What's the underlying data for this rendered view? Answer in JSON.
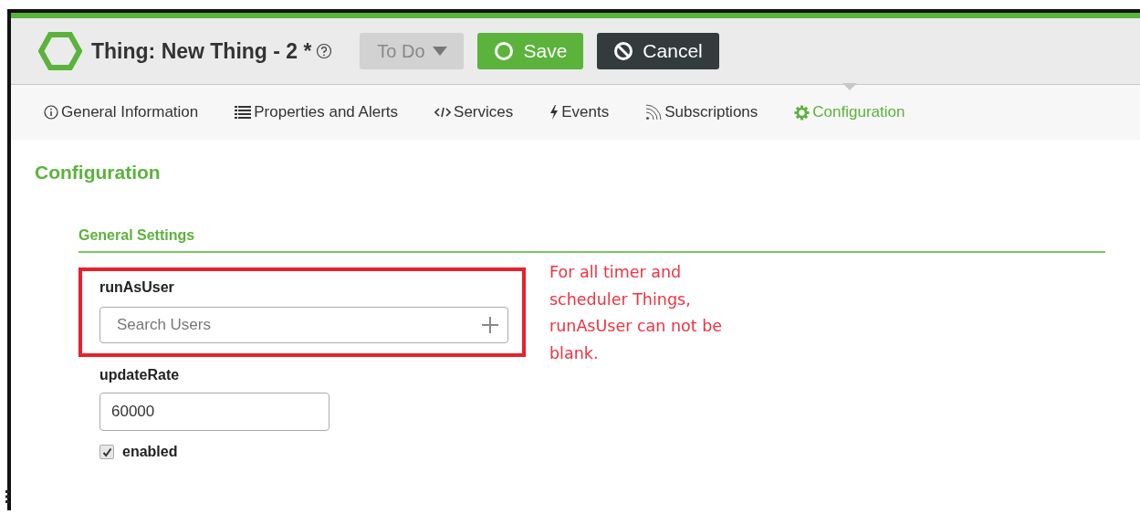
{
  "header": {
    "title": "Thing: New Thing - 2 *",
    "status": {
      "label": "To Do",
      "disabled": true
    },
    "buttons": [
      {
        "kind": "save",
        "label": "Save"
      },
      {
        "kind": "cancel",
        "label": "Cancel"
      }
    ]
  },
  "tabs": [
    {
      "kind": "info",
      "label": "General Information",
      "selected": false
    },
    {
      "kind": "list",
      "label": "Properties and Alerts",
      "selected": false
    },
    {
      "kind": "code",
      "label": "Services",
      "selected": false
    },
    {
      "kind": "bolt",
      "label": "Events",
      "selected": false
    },
    {
      "kind": "feed",
      "label": "Subscriptions",
      "selected": false
    },
    {
      "kind": "gear",
      "label": "Configuration",
      "selected": true
    }
  ],
  "page_title": "Configuration",
  "section": {
    "title": "General Settings",
    "fields": [
      {
        "kind": "search",
        "label": "runAsUser",
        "placeholder": "Search Users",
        "highlighted": true
      },
      {
        "kind": "text",
        "label": "updateRate",
        "value": "60000",
        "highlighted": false
      },
      {
        "kind": "checkbox",
        "label": "enabled",
        "checked": true
      }
    ]
  },
  "annotation": {
    "lines": [
      "For all timer and",
      "scheduler Things,",
      "runAsUser can not be",
      "blank."
    ]
  }
}
